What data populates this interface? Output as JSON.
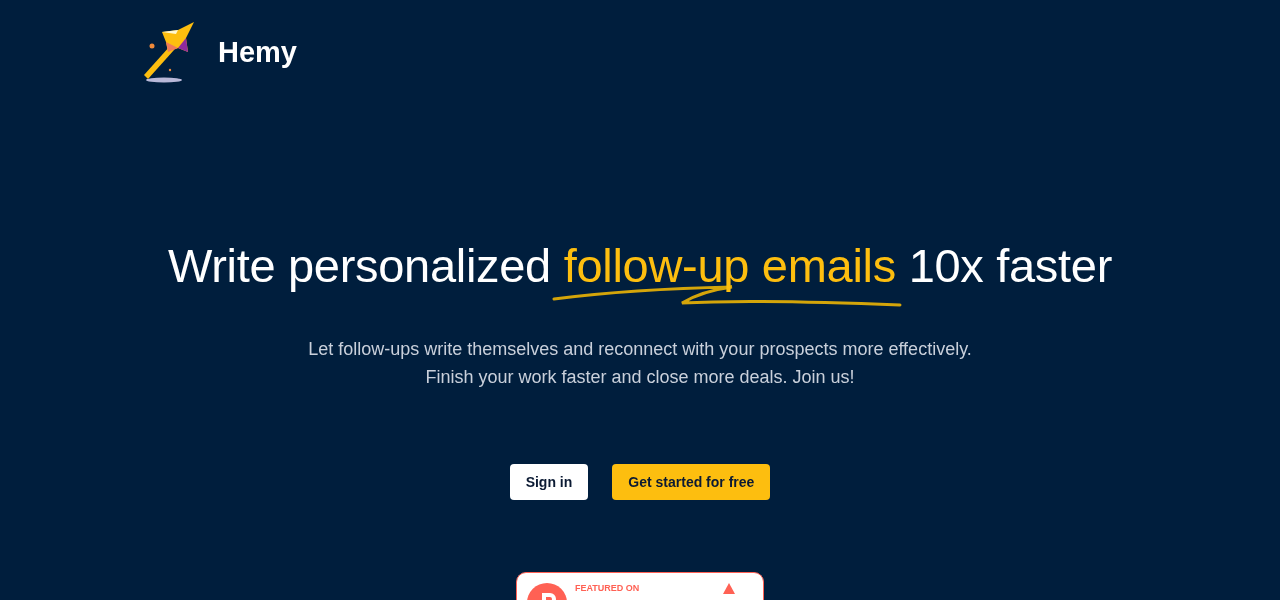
{
  "brand": {
    "name": "Hemy"
  },
  "hero": {
    "headline_start": "Write personalized ",
    "headline_highlight": "follow-up emails",
    "headline_end": " 10x faster",
    "subtitle_lines": [
      "Let follow-ups write themselves and reconnect with your prospects more effectively.",
      "Finish your work faster and close more deals. Join us!"
    ]
  },
  "buttons": [
    {
      "label": "Sign in",
      "kind": "secondary"
    },
    {
      "label": "Get started for free",
      "kind": "primary"
    }
  ],
  "badge": {
    "caption": "FEATURED ON"
  }
}
